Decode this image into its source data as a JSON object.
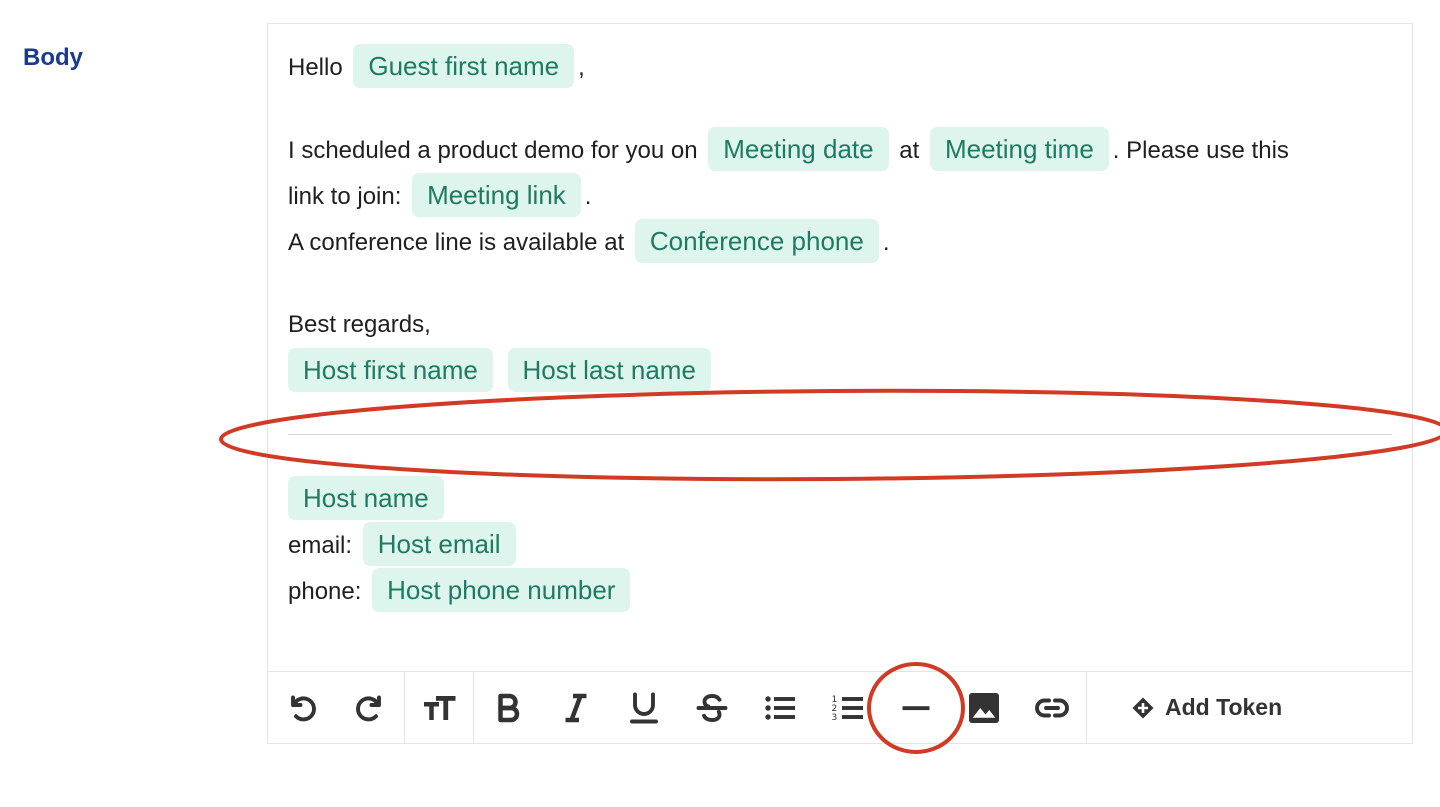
{
  "field": {
    "label": "Body"
  },
  "body": {
    "greeting_prefix": "Hello",
    "token_guest_first_name": "Guest first name",
    "greeting_suffix": ",",
    "l2_prefix": "I scheduled a product demo for you on",
    "token_meeting_date": "Meeting date",
    "l2_mid": "at",
    "token_meeting_time": "Meeting time",
    "l2_suffix": ". Please use this",
    "l3_prefix": "link to join:",
    "token_meeting_link": "Meeting link",
    "l3_suffix": ".",
    "l4_prefix": "A conference line is available at",
    "token_conference_phone": "Conference phone",
    "l4_suffix": ".",
    "closing": "Best regards,",
    "token_host_first_name": "Host first name",
    "token_host_last_name": "Host last name",
    "token_host_name": "Host name",
    "email_label": "email:",
    "token_host_email": "Host email",
    "phone_label": "phone:",
    "token_host_phone": "Host phone number"
  },
  "toolbar": {
    "add_token_label": "Add Token",
    "buttons": [
      "undo-icon",
      "redo-icon",
      "text-size-icon",
      "bold-icon",
      "italic-icon",
      "underline-icon",
      "strikethrough-icon",
      "bulleted-list-icon",
      "numbered-list-icon",
      "horizontal-rule-icon",
      "image-icon",
      "link-icon",
      "add-token-icon"
    ]
  },
  "annotation": {
    "color": "#d13a24"
  }
}
